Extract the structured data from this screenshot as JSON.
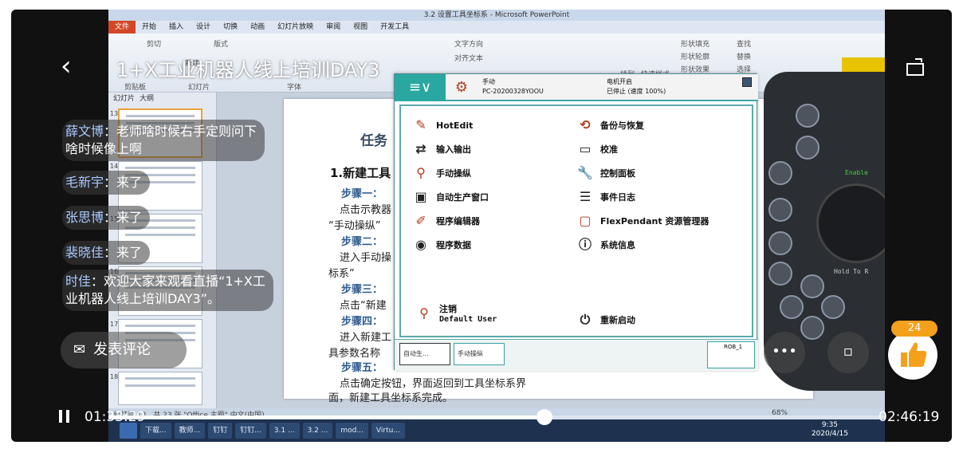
{
  "stream": {
    "title": "1+X工业机器人线上培训DAY3",
    "comment_placeholder": "发表评论",
    "like_count": "24",
    "time_current": "01:33:29",
    "time_total": "02:46:19",
    "progress_fraction": 0.5617
  },
  "chat": [
    {
      "user": "薛文博",
      "text": "老师啥时候右手定则问下",
      "text2": "啥时候像上啊"
    },
    {
      "user": "毛新宇",
      "text": "来了"
    },
    {
      "user": "张思博",
      "text": "来了"
    },
    {
      "user": "裴晓佳",
      "text": "来了"
    },
    {
      "user": "时佳",
      "text": "欢迎大家来观看直播“1+X工",
      "text2": "业机器人线上培训DAY3”。"
    }
  ],
  "powerpoint": {
    "window_title": "3.2 设置工具坐标系 - Microsoft PowerPoint",
    "tabs": [
      "文件",
      "开始",
      "插入",
      "设计",
      "切换",
      "动画",
      "幻灯片放映",
      "审阅",
      "视图",
      "开发工具"
    ],
    "ribbon_groups": [
      "剪贴板",
      "幻灯片",
      "字体"
    ],
    "ribbon_items": [
      "剪切",
      "版式",
      "新建",
      "文字方向",
      "对齐文本",
      "排列",
      "快速样式",
      "形状填充",
      "形状轮廓",
      "形状效果",
      "查找",
      "替换",
      "选择"
    ],
    "pane_tabs": [
      "幻灯片",
      "大纲"
    ],
    "thumb_numbers": [
      "13",
      "14",
      "15",
      "16",
      "17",
      "18"
    ],
    "status": "幻灯片 13，共 23 张  \"Office 主题\"  中文(中国)",
    "zoom": "68%"
  },
  "slide": {
    "title_part": "任务",
    "heading": "1.新建工具",
    "lines": [
      {
        "kind": "step",
        "text": "步骤一："
      },
      {
        "kind": "body",
        "text": "点击示教器"
      },
      {
        "kind": "body",
        "text": "“手动操纵”"
      },
      {
        "kind": "step",
        "text": "步骤二："
      },
      {
        "kind": "body",
        "text": "进入手动操"
      },
      {
        "kind": "body",
        "text": "标系”"
      },
      {
        "kind": "step",
        "text": "步骤三："
      },
      {
        "kind": "body",
        "text": "点击“新建"
      },
      {
        "kind": "step",
        "text": "步骤四："
      },
      {
        "kind": "body",
        "text": "进入新建工"
      },
      {
        "kind": "body",
        "text": "具参数名称"
      },
      {
        "kind": "step",
        "text": "步骤五："
      },
      {
        "kind": "body",
        "text": "点击确定按钮，界面返回到工具坐标系界"
      },
      {
        "kind": "body",
        "text": "面，新建工具坐标系完成。"
      }
    ]
  },
  "flexpendant": {
    "menu_symbol": "≡∨",
    "status_mode": "手动",
    "status_id": "PC-20200328YOOU",
    "status_motor": "电机开启",
    "status_speed": "已停止 (速度 100%)",
    "menu_left": [
      {
        "label": "HotEdit",
        "icon": "hotedit-icon"
      },
      {
        "label": "输入输出",
        "icon": "io-icon"
      },
      {
        "label": "手动操纵",
        "icon": "jog-icon"
      },
      {
        "label": "自动生产窗口",
        "icon": "auto-production-icon"
      },
      {
        "label": "程序编辑器",
        "icon": "program-editor-icon"
      },
      {
        "label": "程序数据",
        "icon": "program-data-icon"
      }
    ],
    "menu_right": [
      {
        "label": "备份与恢复",
        "icon": "backup-icon"
      },
      {
        "label": "校准",
        "icon": "calibration-icon"
      },
      {
        "label": "控制面板",
        "icon": "control-panel-icon"
      },
      {
        "label": "事件日志",
        "icon": "event-log-icon"
      },
      {
        "label": "FlexPendant 资源管理器",
        "icon": "explorer-icon"
      },
      {
        "label": "系统信息",
        "icon": "system-info-icon"
      }
    ],
    "logout_label": "注销",
    "logout_user": "Default User",
    "restart_label": "重新启动",
    "taskbar": [
      "自动生...",
      "手动操纵"
    ],
    "quickset": "ROB_1"
  },
  "pendant_texts": {
    "enable": "Enable",
    "hold": "Hold To R"
  },
  "windows_taskbar": {
    "items": [
      "下载...",
      "教师...",
      "钉钉",
      "钉钉...",
      "3.1 ...",
      "3.2 ...",
      "mod...",
      "Virtu..."
    ],
    "time": "9:35",
    "date": "2020/4/15"
  }
}
